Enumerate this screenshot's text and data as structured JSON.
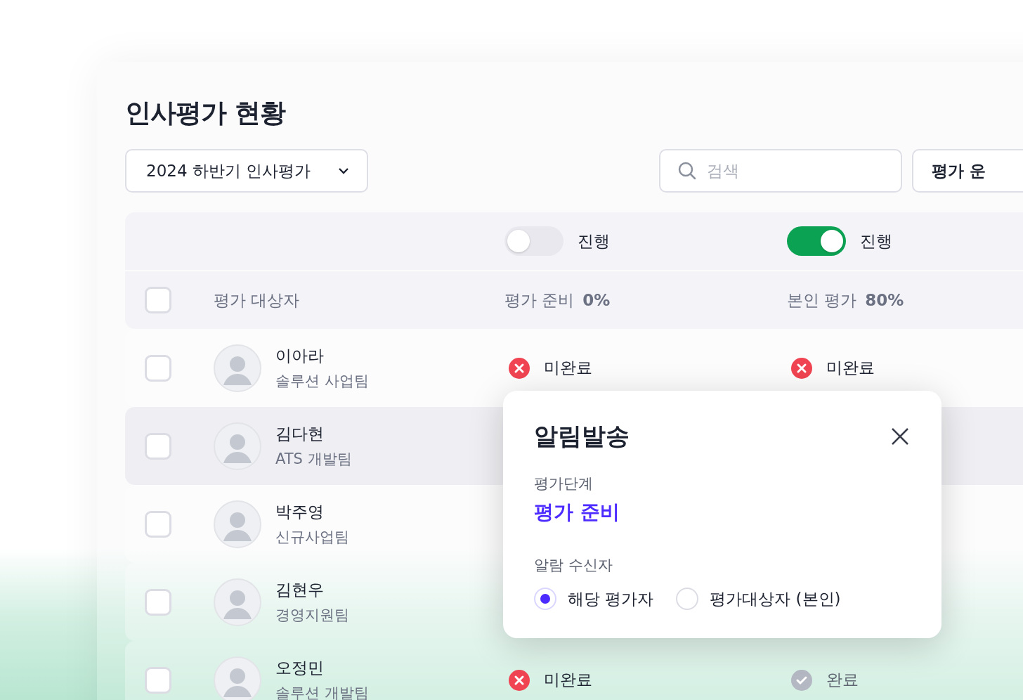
{
  "title": "인사평가 현황",
  "period_dropdown": {
    "value": "2024 하반기 인사평가"
  },
  "search": {
    "placeholder": "검색"
  },
  "top_button": {
    "label": "평가 운"
  },
  "table": {
    "phase_toggles": [
      {
        "label": "진행",
        "on": false
      },
      {
        "label": "진행",
        "on": true
      }
    ],
    "header": {
      "select_all": {
        "checked": false
      },
      "subject": "평가 대상자",
      "phases": [
        {
          "name": "평가 준비",
          "percent": "0%"
        },
        {
          "name": "본인 평가",
          "percent": "80%"
        }
      ]
    },
    "rows": [
      {
        "name": "이아라",
        "team": "솔루션 사업팀",
        "checked": false,
        "highlighted": false,
        "statuses": [
          {
            "kind": "incomplete",
            "label": "미완료"
          },
          {
            "kind": "incomplete",
            "label": "미완료"
          }
        ]
      },
      {
        "name": "김다현",
        "team": "ATS 개발팀",
        "checked": false,
        "highlighted": true,
        "statuses": []
      },
      {
        "name": "박주영",
        "team": "신규사업팀",
        "checked": false,
        "highlighted": false,
        "statuses": []
      },
      {
        "name": "김현우",
        "team": "경영지원팀",
        "checked": false,
        "highlighted": false,
        "statuses": []
      },
      {
        "name": "오정민",
        "team": "솔루션 개발팀",
        "checked": false,
        "highlighted": false,
        "statuses": [
          {
            "kind": "incomplete",
            "label": "미완료"
          },
          {
            "kind": "complete",
            "label": "완료"
          }
        ]
      }
    ]
  },
  "notify_dialog": {
    "title": "알림발송",
    "stage_label": "평가단계",
    "stage_value": "평가 준비",
    "recipients_label": "알람 수신자",
    "recipients": [
      {
        "label": "해당 평가자",
        "selected": true
      },
      {
        "label": "평가대상자 (본인)",
        "selected": false
      }
    ]
  }
}
